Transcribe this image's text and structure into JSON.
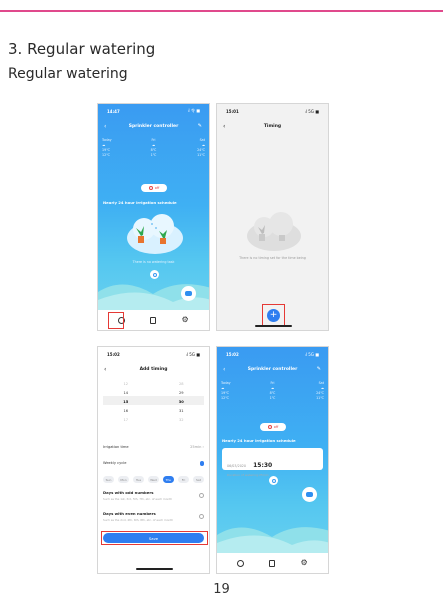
{
  "section_title": "3. Regular watering",
  "subtitle": "Regular watering",
  "page_number": "19",
  "screens": {
    "controller": {
      "time": "14:47",
      "status_right": "ᵢl 令 ■",
      "title": "Sprinkler controller",
      "weather_rows": [
        [
          "Today",
          "Fri",
          "Sat"
        ],
        [
          "☁",
          "☁",
          "☁"
        ],
        [
          "19℃",
          "8℃",
          "24℃"
        ],
        [
          "12℃",
          "1℃",
          "11℃"
        ]
      ],
      "off_label": "off",
      "schedule_title": "Nearly 24 hour irrigation schedule",
      "empty_message": "There is no watering task"
    },
    "timing": {
      "time": "15:01",
      "status_right": "ᵢl 5G ■",
      "title": "Timing",
      "empty_message": "There is no timing set for the time being",
      "add_icon": "+"
    },
    "add_timing": {
      "time": "15:02",
      "status_right": "ᵢl 5G ■",
      "title": "Add timing",
      "picker_rows": [
        [
          "12",
          "28"
        ],
        [
          "14",
          "29"
        ],
        [
          "15",
          "30"
        ],
        [
          "16",
          "31"
        ],
        [
          "17",
          "32"
        ]
      ],
      "irrigation_time_label": "Irrigation time",
      "irrigation_time_value": "25min  ›",
      "weekly_cycle_label": "Weekly cycle",
      "days": [
        "Sun",
        "Mon",
        "Tue",
        "Wed",
        "Thu",
        "Fri",
        "Sat"
      ],
      "selected_day_index": 4,
      "odd_title": "Days with odd numbers",
      "odd_desc": "Such as the 1st, 3rd, 5th, 7th, etc. of each month",
      "even_title": "Days with even numbers",
      "even_desc": "Such as the 2nd, 4th, 6th, 8th, etc. of each month",
      "save_label": "Save"
    },
    "controller_scheduled": {
      "time": "15:02",
      "status_right": "ᵢl 5G ■",
      "title": "Sprinkler controller",
      "weather_rows": [
        [
          "Today",
          "Fri",
          "Sat"
        ],
        [
          "☁",
          "☁",
          "☁"
        ],
        [
          "19℃",
          "8℃",
          "24℃"
        ],
        [
          "12℃",
          "1℃",
          "11℃"
        ]
      ],
      "off_label": "off",
      "schedule_title": "Nearly 24 hour irrigation schedule",
      "schedule_date": "06/03/2020",
      "schedule_time": "15:30",
      "schedule_duration": "Duration of watering:25min"
    }
  },
  "icons": {
    "clock_tab": "clock-icon",
    "doc_tab": "document-icon",
    "settings_tab": "gear-icon",
    "chat_fab": "chat-icon",
    "off_power": "power-icon"
  },
  "colors": {
    "accent_line": "#e0498c",
    "app_blue": "#2f7ef0",
    "highlight_box": "#e53935"
  }
}
